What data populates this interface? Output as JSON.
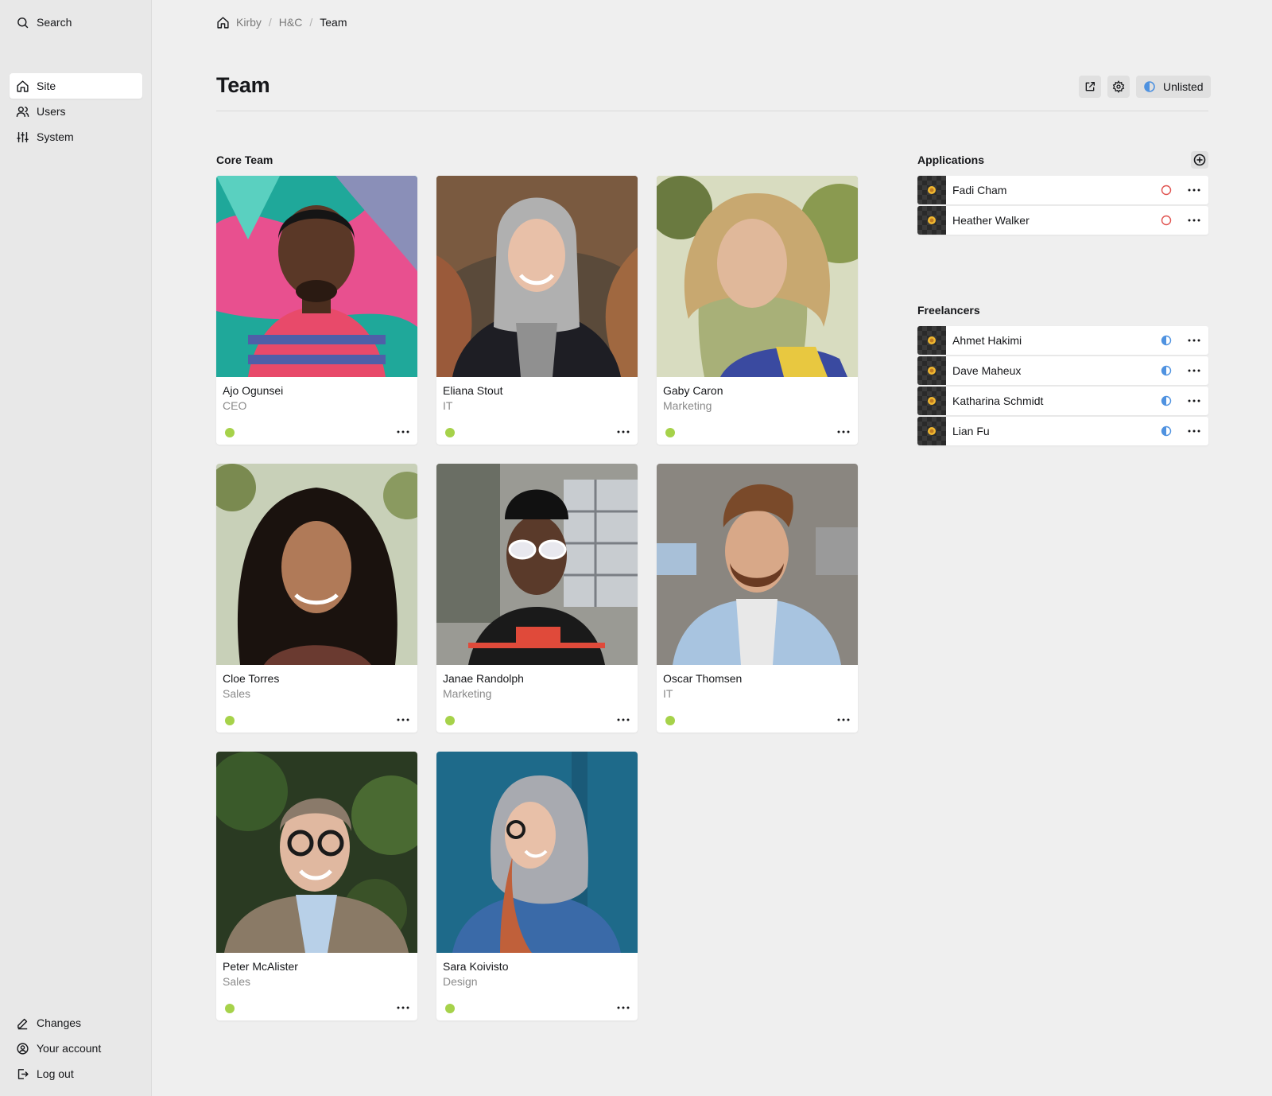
{
  "sidebar": {
    "search_label": "Search",
    "menu": [
      {
        "label": "Site",
        "icon": "home-icon",
        "active": true
      },
      {
        "label": "Users",
        "icon": "users-icon",
        "active": false
      },
      {
        "label": "System",
        "icon": "sliders-icon",
        "active": false
      }
    ],
    "bottom": [
      {
        "label": "Changes",
        "icon": "pen-icon"
      },
      {
        "label": "Your account",
        "icon": "account-icon"
      },
      {
        "label": "Log out",
        "icon": "logout-icon"
      }
    ]
  },
  "breadcrumb": [
    "Kirby",
    "H&C",
    "Team"
  ],
  "page": {
    "title": "Team",
    "status_label": "Unlisted"
  },
  "core_team": {
    "label": "Core Team",
    "members": [
      {
        "name": "Ajo Ogunsei",
        "role": "CEO"
      },
      {
        "name": "Eliana Stout",
        "role": "IT"
      },
      {
        "name": "Gaby Caron",
        "role": "Marketing"
      },
      {
        "name": "Cloe Torres",
        "role": "Sales"
      },
      {
        "name": "Janae Randolph",
        "role": "Marketing"
      },
      {
        "name": "Oscar Thomsen",
        "role": "IT"
      },
      {
        "name": "Peter McAlister",
        "role": "Sales"
      },
      {
        "name": "Sara Koivisto",
        "role": "Design"
      }
    ]
  },
  "applications": {
    "label": "Applications",
    "items": [
      {
        "name": "Fadi Cham",
        "status": "draft"
      },
      {
        "name": "Heather Walker",
        "status": "draft"
      }
    ]
  },
  "freelancers": {
    "label": "Freelancers",
    "items": [
      {
        "name": "Ahmet Hakimi",
        "status": "unlisted"
      },
      {
        "name": "Dave Maheux",
        "status": "unlisted"
      },
      {
        "name": "Katharina Schmidt",
        "status": "unlisted"
      },
      {
        "name": "Lian Fu",
        "status": "unlisted"
      }
    ]
  },
  "colors": {
    "published": "#a6d24a",
    "unlisted": "#4f92e0",
    "draft": "#e0524f"
  }
}
